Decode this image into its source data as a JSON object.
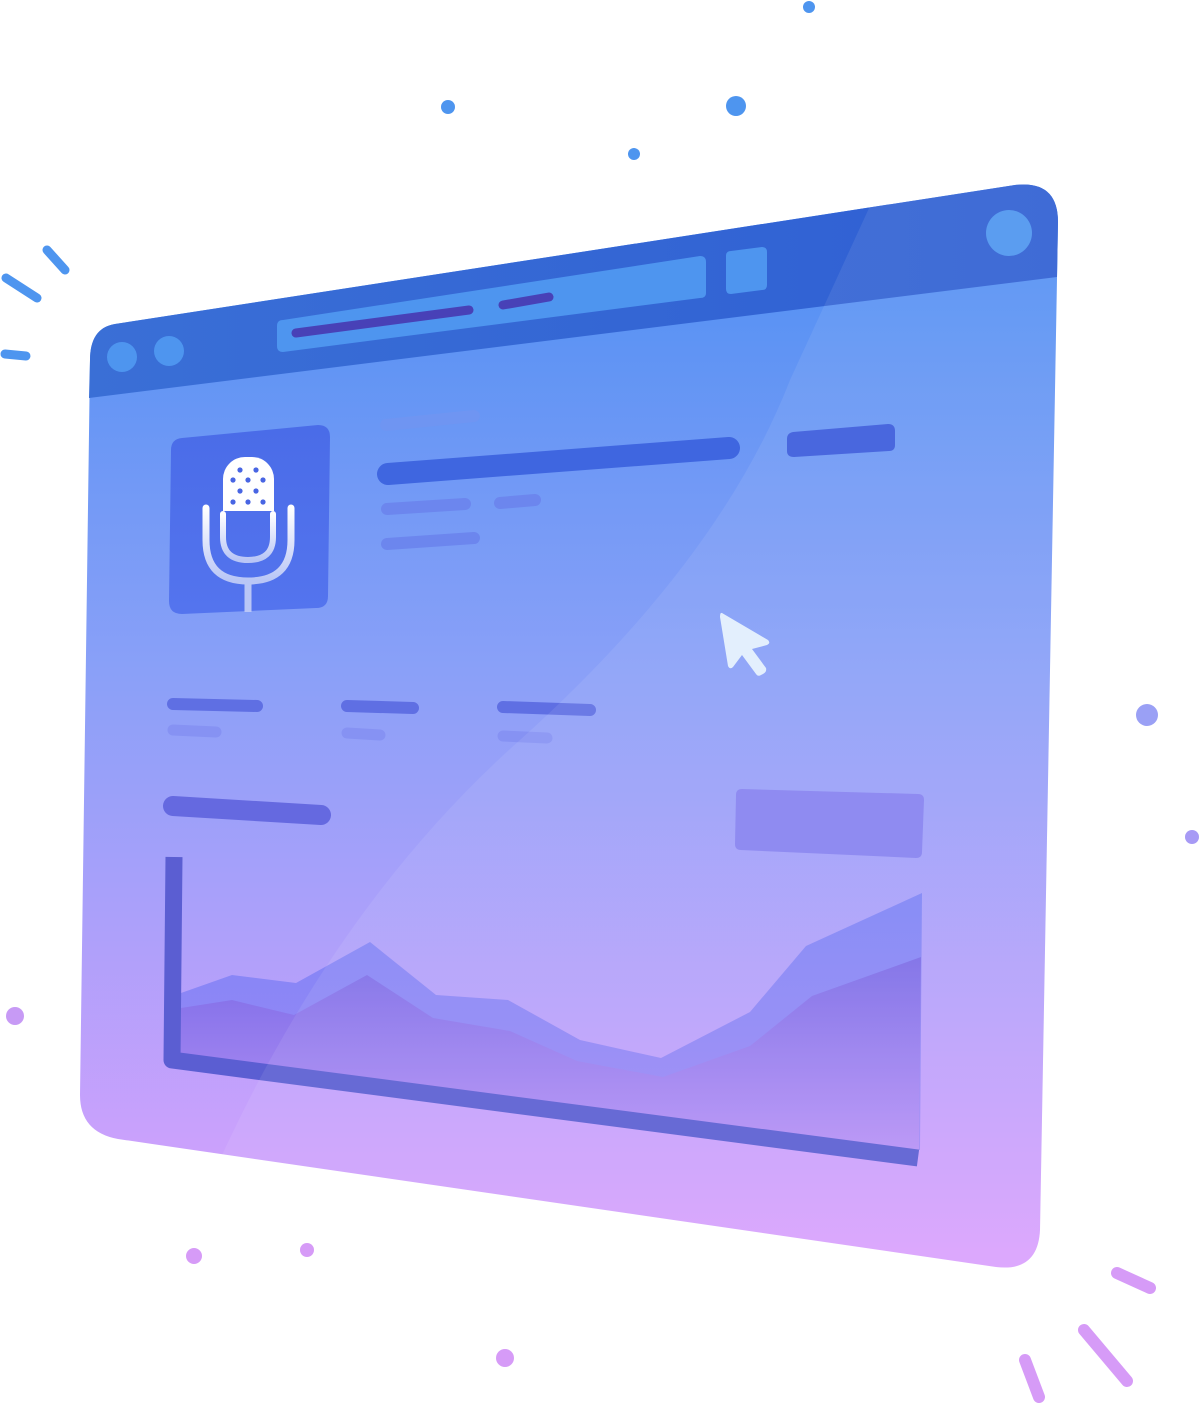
{
  "illustration": {
    "subject": "podcast-analytics-browser-window",
    "colors": {
      "chrome_top": "#3560d4",
      "window_top": "#4d8ff2",
      "window_mid": "#8da1f8",
      "window_bottom": "#d6a2fd",
      "accent_bar": "#3a5bdc",
      "artwork_tile": "#4c6ce9",
      "chart_area_back": "#7f7ff5",
      "chart_area_front": "#7d62e0",
      "axis": "#5a5ccf",
      "cursor": "#e3effd",
      "confetti_blue": "#4e95ef",
      "confetti_purple": "#c79af5"
    },
    "icons": [
      "microphone-icon",
      "cursor-arrow-icon"
    ]
  }
}
